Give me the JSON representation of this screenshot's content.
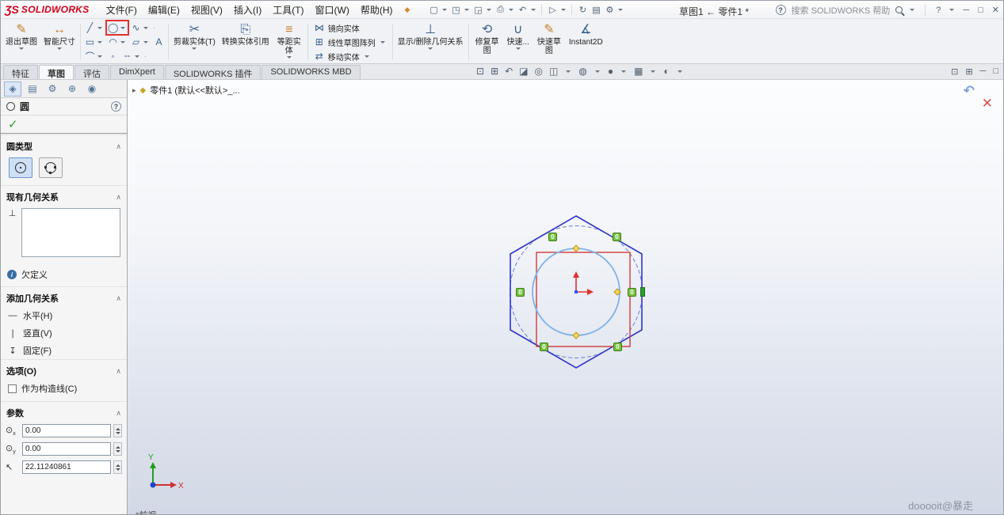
{
  "titlebar": {
    "logo_mark": "ƷS",
    "logo_text": "SOLIDWORKS",
    "menus": [
      "文件(F)",
      "编辑(E)",
      "视图(V)",
      "插入(I)",
      "工具(T)",
      "窗口(W)",
      "帮助(H)"
    ],
    "doc_title": "草图1 ← 零件1 *",
    "search_text": "搜索 SOLIDWORKS 帮助",
    "help_q": "?"
  },
  "icons": {
    "pin": "◆",
    "new": "▢",
    "open": "◳",
    "save": "◲",
    "print": "⎙",
    "undo": "↶",
    "select": "▷",
    "rebuild": "↻",
    "props": "▤",
    "options": "⚙",
    "help": "?",
    "minimize": "─",
    "maximize": "□",
    "close": "✕",
    "exit_sketch": "✎",
    "smart_dim": "↔",
    "line": "╱",
    "circle": "◯",
    "spline": "∿",
    "rect": "▭",
    "arc": "◠",
    "slot": "▱",
    "text_tool": "A",
    "fillet": "⌒",
    "point": "◦",
    "construction": "╌",
    "trim": "✂",
    "convert": "⎘",
    "offset": "≡",
    "mirror": "⋈",
    "pattern": "⊞",
    "move": "⇄",
    "relations": "⊥",
    "repair": "⟲",
    "quick_snap": "∪",
    "quick_sketch": "✎",
    "instant2d": "∡",
    "perpendicular": "⊥",
    "horizontal": "―",
    "vertical": "∣",
    "fixed": "↧",
    "chevron": "∧",
    "check": "✓",
    "confirm": "↶",
    "cancel": "✕",
    "tree_caret": "▸",
    "part": "◆",
    "dot": "·"
  },
  "headsup": [
    "⊡",
    "⊞",
    "↶",
    "◪",
    "◎",
    "◫",
    "◍",
    "●",
    "▦",
    "◐"
  ],
  "panel_tabs": [
    "◈",
    "▤",
    "⚙",
    "⊕",
    "◉"
  ],
  "ribbon": {
    "exit_sketch": "退出草图",
    "smart_dim": "智能尺寸",
    "trim": "剪裁实体(T)",
    "convert": "转换实体引用",
    "offset": "等距实体",
    "mirror": "镜向实体",
    "pattern": "线性草图阵列",
    "move": "移动实体",
    "relations": "显示/删除几何关系",
    "repair": "修复草图",
    "quick_snap": "快速...",
    "quick_sketch": "快速草图",
    "instant2d": "Instant2D"
  },
  "tabs": [
    "特征",
    "草图",
    "评估",
    "DimXpert",
    "SOLIDWORKS 插件",
    "SOLIDWORKS MBD"
  ],
  "panel": {
    "title": "圆",
    "sec_circle_type": "圆类型",
    "sec_existing": "现有几何关系",
    "status": "欠定义",
    "sec_add": "添加几何关系",
    "rel_horizontal": "水平(H)",
    "rel_vertical": "竖直(V)",
    "rel_fixed": "固定(F)",
    "sec_options": "选项(O)",
    "opt_construction": "作为构造线(C)",
    "sec_params": "参数",
    "param_x": "0.00",
    "param_y": "0.00",
    "param_r": "22.11240861",
    "info_i": "i"
  },
  "viewport": {
    "tree_root": "零件1 (默认<<默认>_...",
    "view_label": "*前视",
    "watermark": "dooooit@暴走",
    "badge": "0",
    "axis_x": "X",
    "axis_y": "Y"
  }
}
